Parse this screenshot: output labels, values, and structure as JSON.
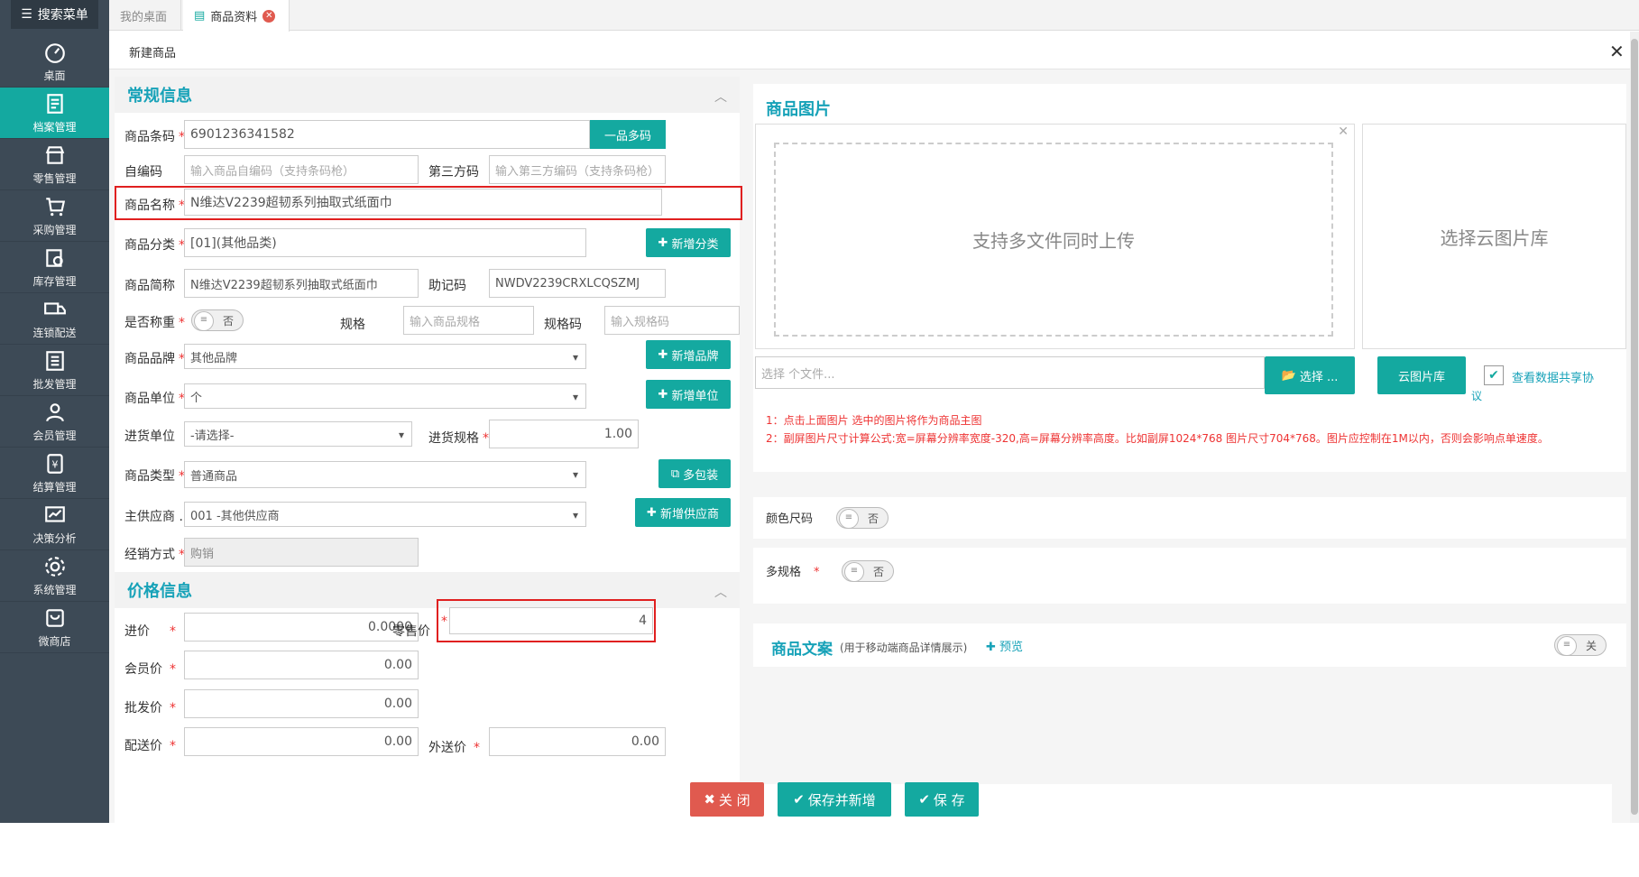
{
  "sidebar": {
    "search_label": "搜索菜单",
    "items": [
      {
        "label": "桌面",
        "icon": "dashboard-icon"
      },
      {
        "label": "档案管理",
        "icon": "archive-icon"
      },
      {
        "label": "零售管理",
        "icon": "store-icon"
      },
      {
        "label": "采购管理",
        "icon": "cart-icon"
      },
      {
        "label": "库存管理",
        "icon": "inventory-icon"
      },
      {
        "label": "连锁配送",
        "icon": "truck-icon"
      },
      {
        "label": "批发管理",
        "icon": "wholesale-icon"
      },
      {
        "label": "会员管理",
        "icon": "member-icon"
      },
      {
        "label": "结算管理",
        "icon": "settlement-icon"
      },
      {
        "label": "决策分析",
        "icon": "chart-icon"
      },
      {
        "label": "系统管理",
        "icon": "gear-icon"
      },
      {
        "label": "微商店",
        "icon": "shop-icon"
      }
    ],
    "active_index": 1
  },
  "tabs": {
    "home": "我的桌面",
    "product": "商品资料"
  },
  "modal": {
    "title": "新建商品"
  },
  "general": {
    "title": "常规信息",
    "barcode_label": "商品条码",
    "barcode_value": "6901236341582",
    "multi_code_btn": "一品多码",
    "selfcode_label": "自编码",
    "selfcode_ph": "输入商品自编码（支持条码枪）",
    "thirdcode_label": "第三方码",
    "thirdcode_ph": "输入第三方编码（支持条码枪）",
    "name_label": "商品名称",
    "name_value": "N维达V2239超韧系列抽取式纸面巾",
    "category_label": "商品分类",
    "category_value": "[01](其他品类)",
    "add_category_btn": "新增分类",
    "short_label": "商品简称",
    "short_value": "N维达V2239超韧系列抽取式纸面巾",
    "mnemonic_label": "助记码",
    "mnemonic_value": "NWDV2239CRXLCQSZMJ",
    "weigh_label": "是否称重",
    "weigh_toggle": "否",
    "spec_label": "规格",
    "spec_ph": "输入商品规格",
    "speccode_label": "规格码",
    "speccode_ph": "输入规格码",
    "brand_label": "商品品牌",
    "brand_value": "其他品牌",
    "add_brand_btn": "新增品牌",
    "unit_label": "商品单位",
    "unit_value": "个",
    "add_unit_btn": "新增单位",
    "purchase_unit_label": "进货单位",
    "purchase_unit_value": "-请选择-",
    "purchase_spec_label": "进货规格",
    "purchase_spec_value": "1.00",
    "type_label": "商品类型",
    "type_value": "普通商品",
    "multi_pack_btn": "多包装",
    "supplier_label": "主供应商 ...",
    "supplier_value": "001 -其他供应商",
    "add_supplier_btn": "新增供应商",
    "sale_mode_label": "经销方式",
    "sale_mode_value": "购销"
  },
  "price": {
    "title": "价格信息",
    "purchase_label": "进价",
    "purchase_value": "0.0000",
    "retail_label": "零售价",
    "retail_value": "4",
    "member_label": "会员价",
    "member_value": "0.00",
    "wholesale_label": "批发价",
    "wholesale_value": "0.00",
    "dist_label": "配送价",
    "dist_value": "0.00",
    "external_label": "外送价",
    "external_value": "0.00"
  },
  "images": {
    "title": "商品图片",
    "upload_text": "支持多文件同时上传",
    "cloud_text": "选择云图片库",
    "file_ph": "选择 个文件...",
    "choose_btn": "选择 ...",
    "cloud_btn": "云图片库",
    "share_text": "查看数据共享协",
    "share_text2": "议",
    "note1": "1：点击上面图片 选中的图片将作为商品主图",
    "note2": "2：副屏图片尺寸计算公式:宽=屏幕分辨率宽度-320,高=屏幕分辨率高度。比如副屏1024*768 图片尺寸704*768。图片应控制在1M以内，否则会影响点单速度。"
  },
  "color_size": {
    "label": "颜色尺码",
    "toggle": "否"
  },
  "multi_spec": {
    "label": "多规格",
    "toggle": "否"
  },
  "copy": {
    "title": "商品文案",
    "subtitle": "(用于移动端商品详情展示)",
    "preview": "预览",
    "toggle": "关"
  },
  "footer": {
    "close": "关 闭",
    "save_new": "保存并新增",
    "save": "保 存"
  },
  "colors": {
    "accent": "#14a9a0",
    "danger": "#e05a4f",
    "sidebar": "#3d4a56",
    "highlight": "#e02020"
  }
}
